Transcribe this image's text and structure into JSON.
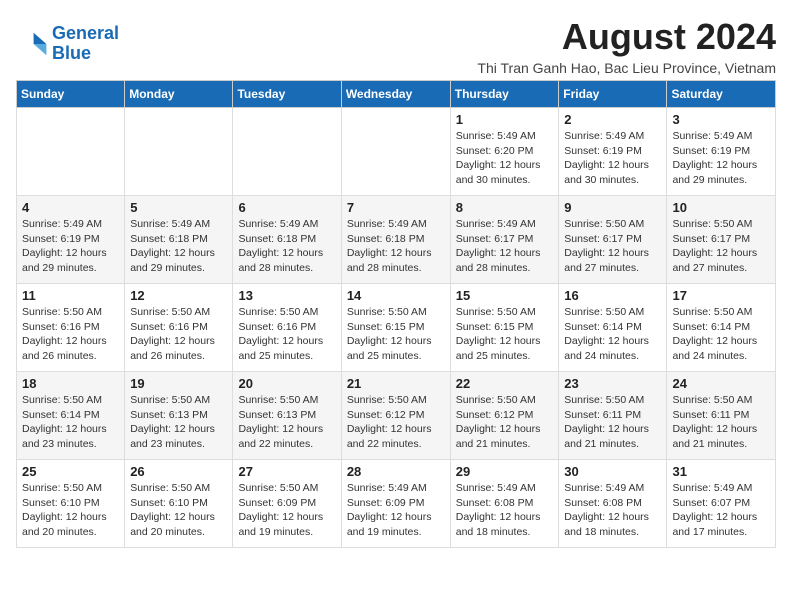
{
  "logo": {
    "line1": "General",
    "line2": "Blue"
  },
  "title": "August 2024",
  "subtitle": "Thi Tran Ganh Hao, Bac Lieu Province, Vietnam",
  "days_of_week": [
    "Sunday",
    "Monday",
    "Tuesday",
    "Wednesday",
    "Thursday",
    "Friday",
    "Saturday"
  ],
  "weeks": [
    [
      {
        "day": "",
        "info": ""
      },
      {
        "day": "",
        "info": ""
      },
      {
        "day": "",
        "info": ""
      },
      {
        "day": "",
        "info": ""
      },
      {
        "day": "1",
        "info": "Sunrise: 5:49 AM\nSunset: 6:20 PM\nDaylight: 12 hours\nand 30 minutes."
      },
      {
        "day": "2",
        "info": "Sunrise: 5:49 AM\nSunset: 6:19 PM\nDaylight: 12 hours\nand 30 minutes."
      },
      {
        "day": "3",
        "info": "Sunrise: 5:49 AM\nSunset: 6:19 PM\nDaylight: 12 hours\nand 29 minutes."
      }
    ],
    [
      {
        "day": "4",
        "info": "Sunrise: 5:49 AM\nSunset: 6:19 PM\nDaylight: 12 hours\nand 29 minutes."
      },
      {
        "day": "5",
        "info": "Sunrise: 5:49 AM\nSunset: 6:18 PM\nDaylight: 12 hours\nand 29 minutes."
      },
      {
        "day": "6",
        "info": "Sunrise: 5:49 AM\nSunset: 6:18 PM\nDaylight: 12 hours\nand 28 minutes."
      },
      {
        "day": "7",
        "info": "Sunrise: 5:49 AM\nSunset: 6:18 PM\nDaylight: 12 hours\nand 28 minutes."
      },
      {
        "day": "8",
        "info": "Sunrise: 5:49 AM\nSunset: 6:17 PM\nDaylight: 12 hours\nand 28 minutes."
      },
      {
        "day": "9",
        "info": "Sunrise: 5:50 AM\nSunset: 6:17 PM\nDaylight: 12 hours\nand 27 minutes."
      },
      {
        "day": "10",
        "info": "Sunrise: 5:50 AM\nSunset: 6:17 PM\nDaylight: 12 hours\nand 27 minutes."
      }
    ],
    [
      {
        "day": "11",
        "info": "Sunrise: 5:50 AM\nSunset: 6:16 PM\nDaylight: 12 hours\nand 26 minutes."
      },
      {
        "day": "12",
        "info": "Sunrise: 5:50 AM\nSunset: 6:16 PM\nDaylight: 12 hours\nand 26 minutes."
      },
      {
        "day": "13",
        "info": "Sunrise: 5:50 AM\nSunset: 6:16 PM\nDaylight: 12 hours\nand 25 minutes."
      },
      {
        "day": "14",
        "info": "Sunrise: 5:50 AM\nSunset: 6:15 PM\nDaylight: 12 hours\nand 25 minutes."
      },
      {
        "day": "15",
        "info": "Sunrise: 5:50 AM\nSunset: 6:15 PM\nDaylight: 12 hours\nand 25 minutes."
      },
      {
        "day": "16",
        "info": "Sunrise: 5:50 AM\nSunset: 6:14 PM\nDaylight: 12 hours\nand 24 minutes."
      },
      {
        "day": "17",
        "info": "Sunrise: 5:50 AM\nSunset: 6:14 PM\nDaylight: 12 hours\nand 24 minutes."
      }
    ],
    [
      {
        "day": "18",
        "info": "Sunrise: 5:50 AM\nSunset: 6:14 PM\nDaylight: 12 hours\nand 23 minutes."
      },
      {
        "day": "19",
        "info": "Sunrise: 5:50 AM\nSunset: 6:13 PM\nDaylight: 12 hours\nand 23 minutes."
      },
      {
        "day": "20",
        "info": "Sunrise: 5:50 AM\nSunset: 6:13 PM\nDaylight: 12 hours\nand 22 minutes."
      },
      {
        "day": "21",
        "info": "Sunrise: 5:50 AM\nSunset: 6:12 PM\nDaylight: 12 hours\nand 22 minutes."
      },
      {
        "day": "22",
        "info": "Sunrise: 5:50 AM\nSunset: 6:12 PM\nDaylight: 12 hours\nand 21 minutes."
      },
      {
        "day": "23",
        "info": "Sunrise: 5:50 AM\nSunset: 6:11 PM\nDaylight: 12 hours\nand 21 minutes."
      },
      {
        "day": "24",
        "info": "Sunrise: 5:50 AM\nSunset: 6:11 PM\nDaylight: 12 hours\nand 21 minutes."
      }
    ],
    [
      {
        "day": "25",
        "info": "Sunrise: 5:50 AM\nSunset: 6:10 PM\nDaylight: 12 hours\nand 20 minutes."
      },
      {
        "day": "26",
        "info": "Sunrise: 5:50 AM\nSunset: 6:10 PM\nDaylight: 12 hours\nand 20 minutes."
      },
      {
        "day": "27",
        "info": "Sunrise: 5:50 AM\nSunset: 6:09 PM\nDaylight: 12 hours\nand 19 minutes."
      },
      {
        "day": "28",
        "info": "Sunrise: 5:49 AM\nSunset: 6:09 PM\nDaylight: 12 hours\nand 19 minutes."
      },
      {
        "day": "29",
        "info": "Sunrise: 5:49 AM\nSunset: 6:08 PM\nDaylight: 12 hours\nand 18 minutes."
      },
      {
        "day": "30",
        "info": "Sunrise: 5:49 AM\nSunset: 6:08 PM\nDaylight: 12 hours\nand 18 minutes."
      },
      {
        "day": "31",
        "info": "Sunrise: 5:49 AM\nSunset: 6:07 PM\nDaylight: 12 hours\nand 17 minutes."
      }
    ]
  ]
}
